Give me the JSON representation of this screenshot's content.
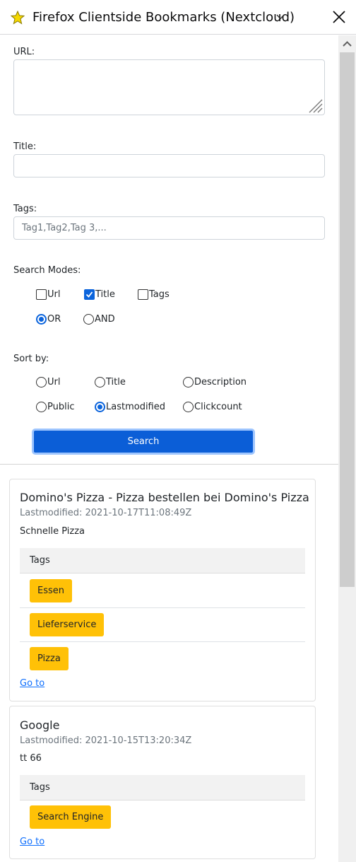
{
  "header": {
    "title": "Firefox Clientside Bookmarks (Nextcloud)",
    "star_color": "#f5d800"
  },
  "form": {
    "url_label": "URL:",
    "url_value": "",
    "title_label": "Title:",
    "title_value": "",
    "tags_label": "Tags:",
    "tags_placeholder": "Tag1,Tag2,Tag 3,...",
    "search_modes_label": "Search Modes:",
    "search_modes": [
      {
        "label": "Url",
        "checked": false
      },
      {
        "label": "Title",
        "checked": true
      },
      {
        "label": "Tags",
        "checked": false
      }
    ],
    "logic_modes": [
      {
        "label": "OR",
        "selected": true
      },
      {
        "label": "AND",
        "selected": false
      }
    ],
    "sort_label": "Sort by:",
    "sort_options": [
      {
        "label": "Url",
        "selected": false
      },
      {
        "label": "Title",
        "selected": false
      },
      {
        "label": "Description",
        "selected": false
      },
      {
        "label": "Public",
        "selected": false
      },
      {
        "label": "Lastmodified",
        "selected": true
      },
      {
        "label": "Clickcount",
        "selected": false
      }
    ],
    "search_button": "Search"
  },
  "results": [
    {
      "title": "Domino's Pizza - Pizza bestellen bei Domino's Pizza",
      "lastmodified": "Lastmodified: 2021-10-17T11:08:49Z",
      "description": "Schnelle Pizza",
      "tags_header": "Tags",
      "tags": [
        "Essen",
        "Lieferservice",
        "Pizza"
      ],
      "goto_label": "Go to"
    },
    {
      "title": "Google",
      "lastmodified": "Lastmodified: 2021-10-15T13:20:34Z",
      "description": "tt 66",
      "tags_header": "Tags",
      "tags": [
        "Search Engine"
      ],
      "goto_label": "Go to"
    }
  ],
  "colors": {
    "accent": "#0b5ed7",
    "tag": "#ffc107",
    "link": "#0d6efd"
  }
}
